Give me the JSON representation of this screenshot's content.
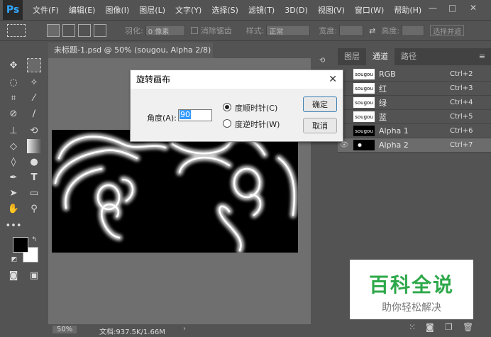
{
  "app": {
    "logo": "Ps"
  },
  "menu": [
    "文件(F)",
    "编辑(E)",
    "图像(I)",
    "图层(L)",
    "文字(Y)",
    "选择(S)",
    "滤镜(T)",
    "3D(D)",
    "视图(V)",
    "窗口(W)",
    "帮助(H)"
  ],
  "window_controls": {
    "minimize": "—",
    "restore": "□",
    "close": "✕"
  },
  "options": {
    "feather_label": "羽化:",
    "feather_value": "0 像素",
    "antialias_label": "消除锯齿",
    "style_label": "样式:",
    "style_value": "正常",
    "width_label": "宽度:",
    "height_label": "高度:",
    "select_mask": "选择并遮"
  },
  "document": {
    "tab_title": "未标题-1.psd @ 50% (sougou, Alpha 2/8) *",
    "zoom": "50%",
    "doc_info": "文档:937.5K/1.66M"
  },
  "panel": {
    "tabs": [
      "图层",
      "通道",
      "路径"
    ],
    "active_tab": "通道",
    "channels": [
      {
        "name": "RGB",
        "shortcut": "Ctrl+2",
        "thumb": "sougou",
        "dark": false,
        "selected": false
      },
      {
        "name": "红",
        "shortcut": "Ctrl+3",
        "thumb": "sougou",
        "dark": false,
        "selected": false
      },
      {
        "name": "绿",
        "shortcut": "Ctrl+4",
        "thumb": "sougou",
        "dark": false,
        "selected": false
      },
      {
        "name": "蓝",
        "shortcut": "Ctrl+5",
        "thumb": "sougou",
        "dark": false,
        "selected": false
      },
      {
        "name": "Alpha 1",
        "shortcut": "Ctrl+6",
        "thumb": "sougou",
        "dark": true,
        "selected": false
      },
      {
        "name": "Alpha 2",
        "shortcut": "Ctrl+7",
        "thumb": "",
        "dark": true,
        "selected": true
      }
    ]
  },
  "dialog": {
    "title": "旋转画布",
    "close": "✕",
    "angle_label": "角度(A):",
    "angle_value": "90",
    "cw_label": "度顺时针(C)",
    "ccw_label": "度逆时针(W)",
    "ok_label": "确定",
    "cancel_label": "取消",
    "cw_checked": true
  },
  "watermark": {
    "title": "百科全说",
    "subtitle": "助你轻松解决"
  },
  "colors": {
    "accent": "#31a8ff",
    "watermark_green": "#2ea84a"
  }
}
